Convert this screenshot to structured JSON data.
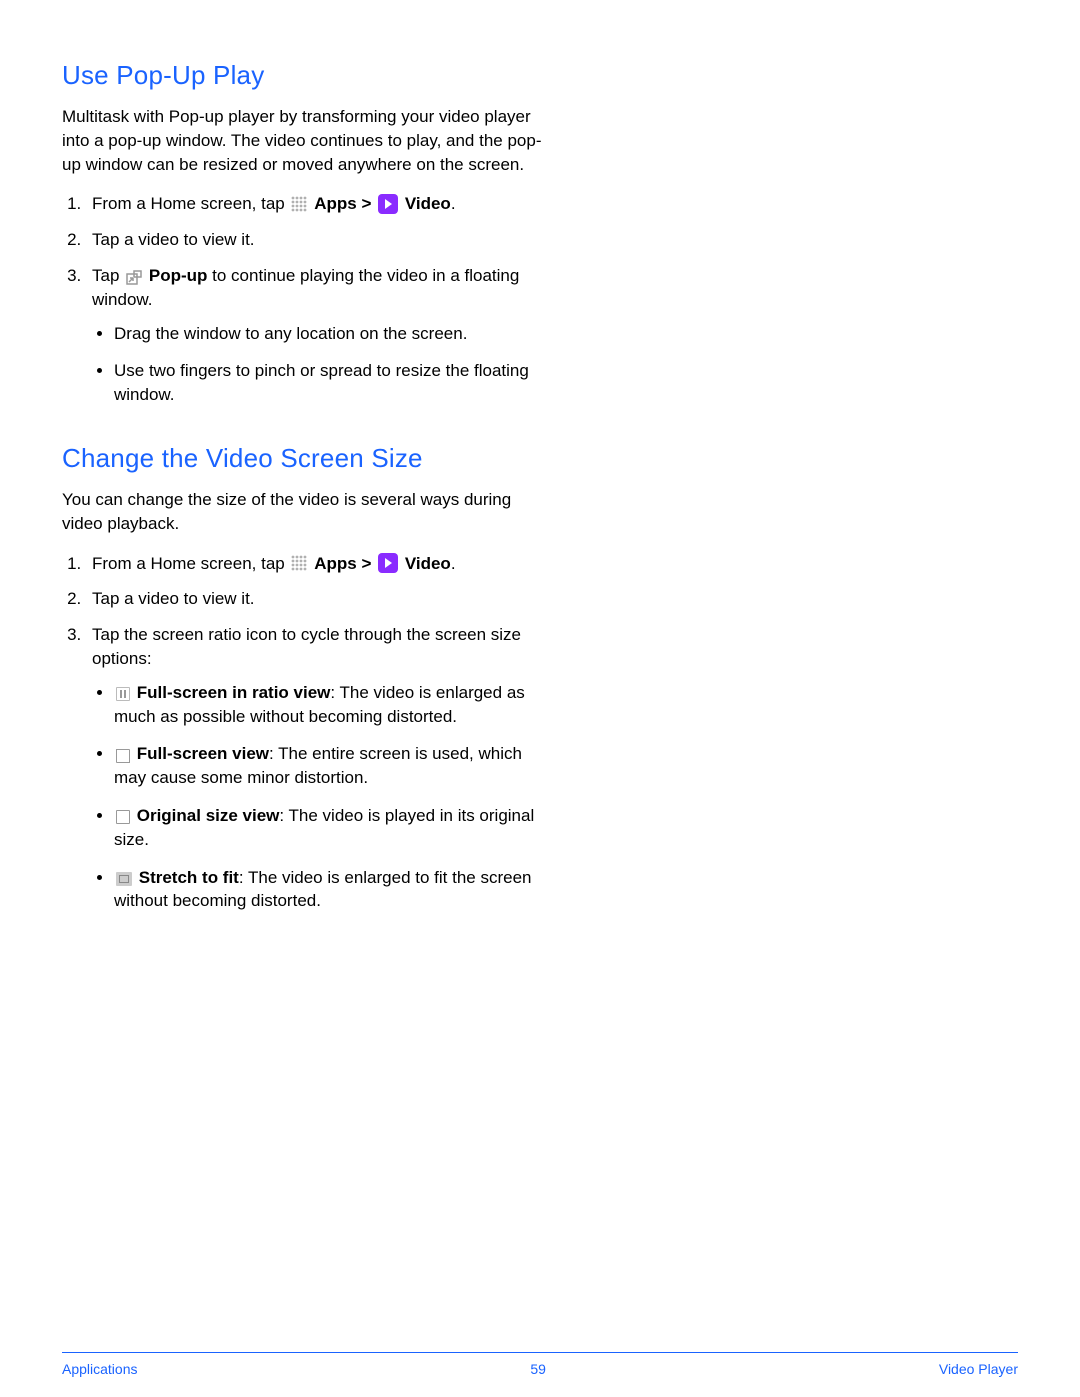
{
  "section1": {
    "heading": "Use Pop-Up Play",
    "intro": "Multitask with Pop-up player by transforming your video player into a pop-up window. The video continues to play, and the pop-up window can be resized or moved anywhere on the screen.",
    "step1_prefix": "From a Home screen, tap ",
    "apps_label": "Apps",
    "gt": " > ",
    "video_label": "Video",
    "period": ".",
    "step2": "Tap a video to view it.",
    "step3_prefix": "Tap ",
    "popup_label": "Pop-up",
    "step3_suffix": " to continue playing the video in a floating window.",
    "bullet1": "Drag the window to any location on the screen.",
    "bullet2": "Use two fingers to pinch or spread to resize the floating window."
  },
  "section2": {
    "heading": "Change the Video Screen Size",
    "intro": "You can change the size of the video is several ways during video playback.",
    "step1_prefix": "From a Home screen, tap ",
    "apps_label": "Apps",
    "gt": " > ",
    "video_label": "Video",
    "period": ".",
    "step2": "Tap a video to view it.",
    "step3": "Tap the screen ratio icon to cycle through the screen size options:",
    "opt1_label": "Full-screen in ratio view",
    "opt1_desc": ": The video is enlarged as much as possible without becoming distorted.",
    "opt2_label": "Full-screen view",
    "opt2_desc": ": The entire screen is used, which may cause some minor distortion.",
    "opt3_label": "Original size view",
    "opt3_desc": ": The video is played in its original size.",
    "opt4_label": "Stretch to fit",
    "opt4_desc": ": The video is enlarged to fit the screen without becoming distorted."
  },
  "footer": {
    "left": "Applications",
    "center": "59",
    "right": "Video Player"
  }
}
